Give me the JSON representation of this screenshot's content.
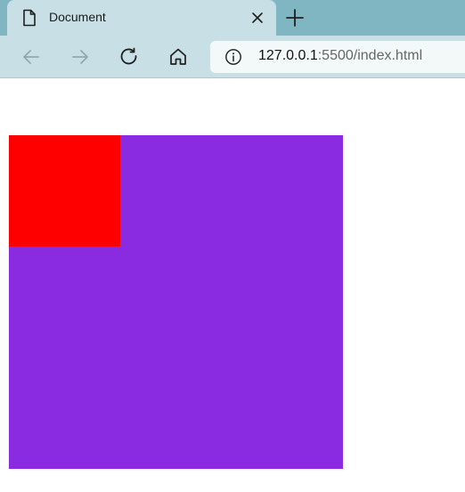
{
  "tab": {
    "title": "Document",
    "icon": "document-icon"
  },
  "toolbar": {
    "back_icon": "arrow-left-icon",
    "forward_icon": "arrow-right-icon",
    "reload_icon": "reload-icon",
    "home_icon": "home-icon",
    "new_tab_icon": "plus-icon"
  },
  "address_bar": {
    "host": "127.0.0.1",
    "rest": ":5500/index.html"
  },
  "page": {
    "outer_box_color": "#8a2be2",
    "inner_box_color": "#ff0000"
  }
}
